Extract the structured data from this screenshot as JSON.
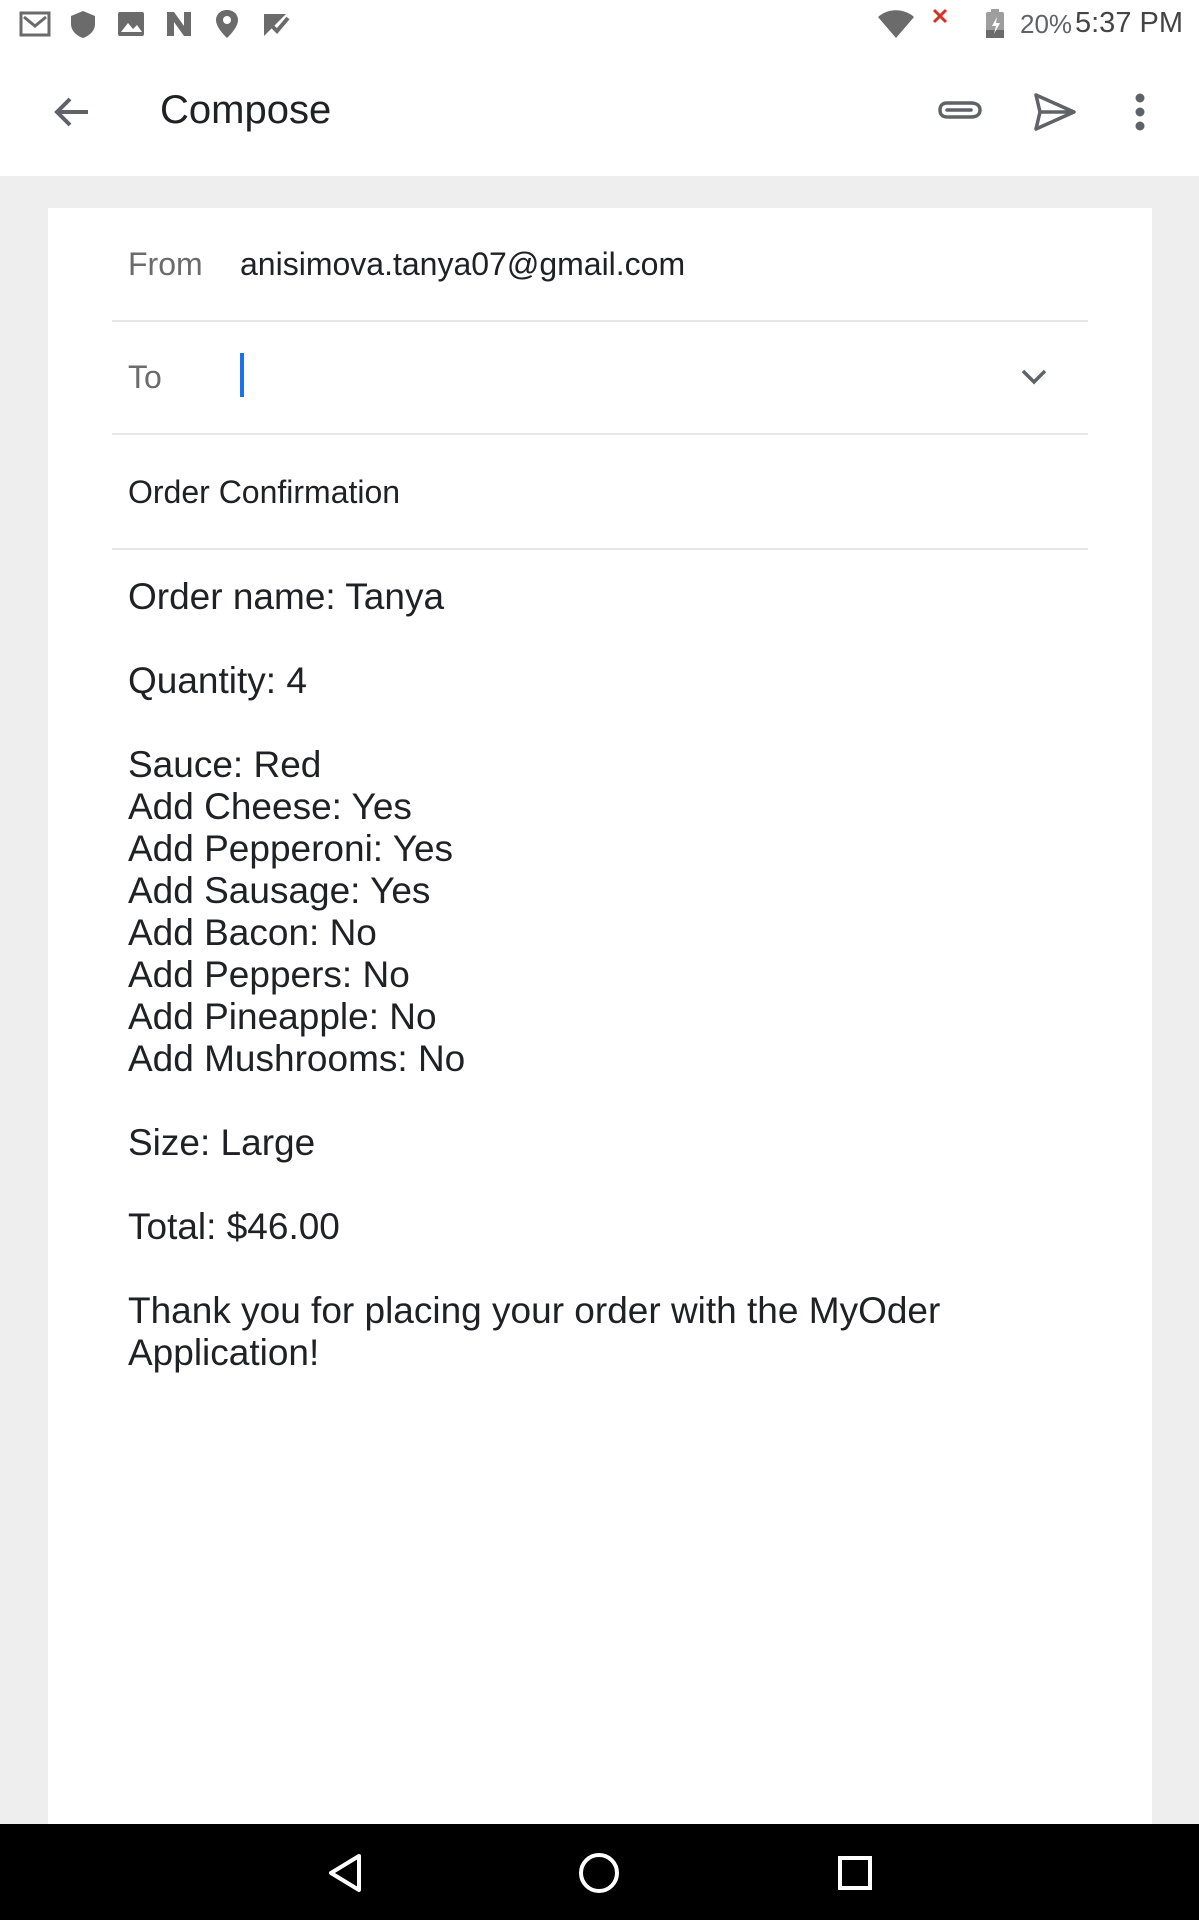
{
  "status_bar": {
    "notification_icons": [
      "gmail-icon",
      "shield-icon",
      "image-icon",
      "n-app-icon",
      "location-icon",
      "check-flag-icon"
    ],
    "battery_percent": "20%",
    "time": "5:37 PM"
  },
  "toolbar": {
    "title": "Compose",
    "back_icon": "arrow-back-icon",
    "attach_icon": "paperclip-icon",
    "send_icon": "send-icon",
    "more_icon": "more-vert-icon"
  },
  "compose": {
    "from_label": "From",
    "from_value": "anisimova.tanya07@gmail.com",
    "to_label": "To",
    "to_value": "",
    "subject": "Order Confirmation",
    "body": "Order name: Tanya\n\nQuantity: 4\n\nSauce: Red\nAdd Cheese: Yes\nAdd Pepperoni: Yes\nAdd Sausage: Yes\nAdd Bacon: No\nAdd Peppers: No\nAdd Pineapple: No\nAdd Mushrooms: No\n\nSize: Large\n\nTotal: $46.00\n\nThank you for placing your order with the MyOder\nApplication!"
  },
  "colors": {
    "accent": "#1a73e8",
    "background": "#eeeeee"
  }
}
